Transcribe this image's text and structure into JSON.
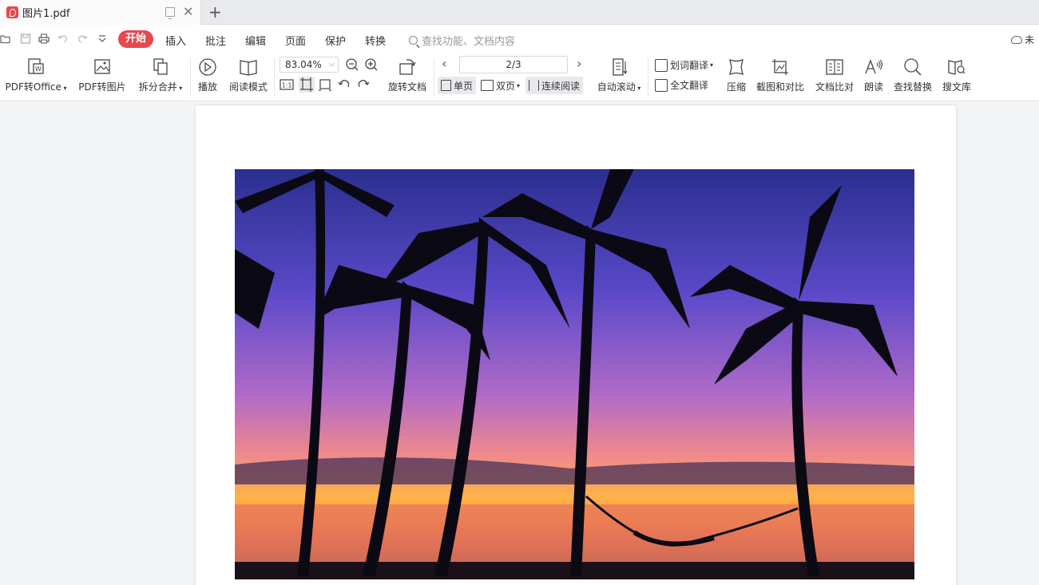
{
  "tab": {
    "title": "图片1.pdf"
  },
  "menu": {
    "start": "开始",
    "items": [
      "插入",
      "批注",
      "编辑",
      "页面",
      "保护",
      "转换"
    ],
    "search_placeholder": "查找功能、文档内容",
    "cloud_label": "未"
  },
  "ribbon": {
    "pdf_to_office": "PDF转Office",
    "pdf_to_image": "PDF转图片",
    "split_merge": "拆分合并",
    "play": "播放",
    "read_mode": "阅读模式",
    "zoom": "83.04%",
    "rotate_doc": "旋转文档",
    "page_indicator": "2/3",
    "single_page": "单页",
    "double_page": "双页",
    "continuous_read": "连续阅读",
    "auto_scroll": "自动滚动",
    "word_translate": "划词翻译",
    "full_translate": "全文翻译",
    "compress": "压缩",
    "screenshot_compare": "截图和对比",
    "doc_compare": "文档比对",
    "read_aloud": "朗读",
    "find_replace": "查找替换",
    "search_library": "搜文库",
    "one_to_one": "1:1"
  },
  "colors": {
    "accent": "#e5484d",
    "ribbon_bg": "#ffffff",
    "canvas_bg": "#f3f4f6"
  }
}
